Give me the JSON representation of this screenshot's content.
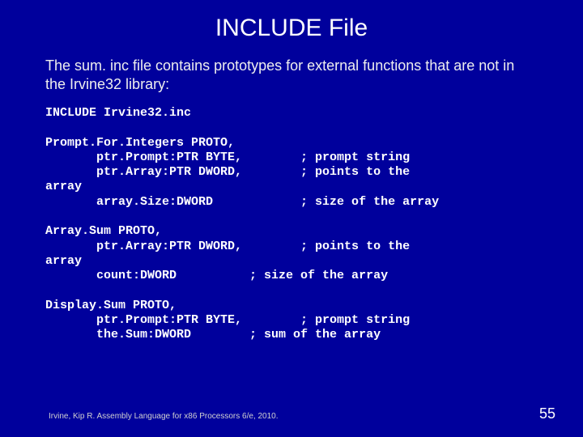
{
  "title": "INCLUDE File",
  "intro": "The sum. inc file contains prototypes for external functions that are not in the Irvine32 library:",
  "code": "INCLUDE Irvine32.inc\n\nPrompt.For.Integers PROTO,\n       ptr.Prompt:PTR BYTE,        ; prompt string\n       ptr.Array:PTR DWORD,        ; points to the\narray\n       array.Size:DWORD            ; size of the array\n\nArray.Sum PROTO,\n       ptr.Array:PTR DWORD,        ; points to the\narray\n       count:DWORD          ; size of the array\n\nDisplay.Sum PROTO,\n       ptr.Prompt:PTR BYTE,        ; prompt string\n       the.Sum:DWORD        ; sum of the array",
  "footer": "Irvine, Kip R. Assembly Language for x86 Processors 6/e, 2010.",
  "page": "55"
}
